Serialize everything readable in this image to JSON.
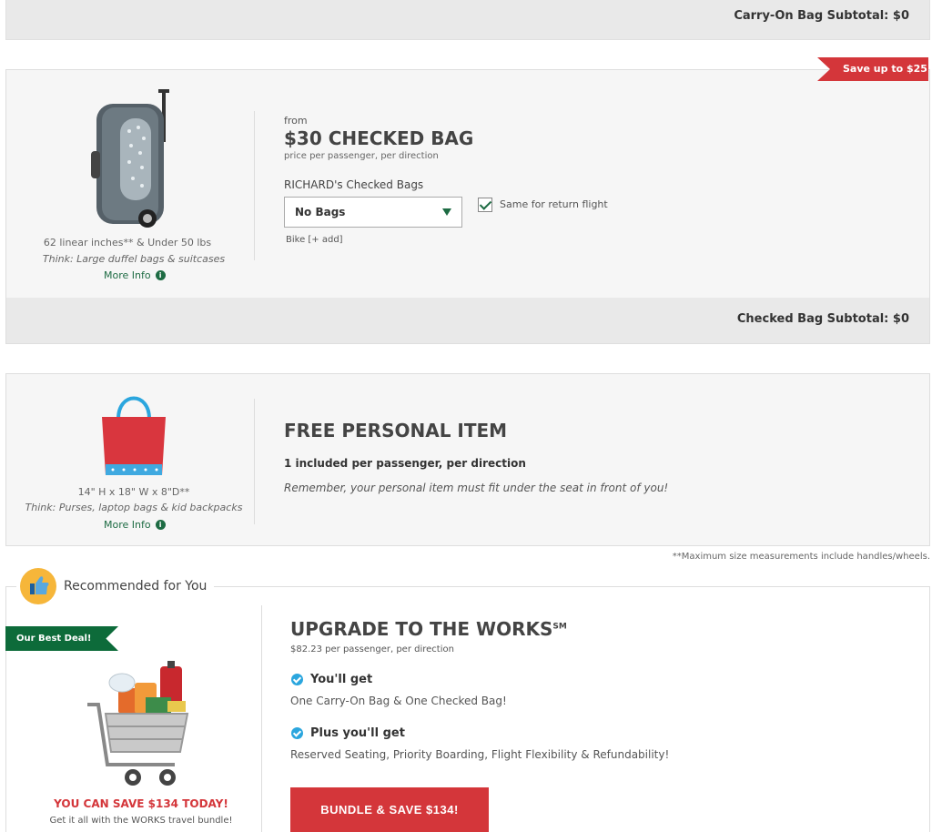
{
  "carryon": {
    "subtotal_label": "Carry-On Bag Subtotal: $0"
  },
  "checked": {
    "ribbon": "Save up to $25",
    "size": "62 linear inches** & Under 50 lbs",
    "think": "Think: Large duffel bags & suitcases",
    "more_info": "More Info",
    "from": "from",
    "title": "$30 CHECKED BAG",
    "subtitle": "price per passenger, per direction",
    "passenger_label": "RICHARD's Checked Bags",
    "select_value": "No Bags",
    "return_label": "Same for return flight",
    "return_checked": true,
    "bike_link": "Bike [+ add]",
    "subtotal_label": "Checked Bag Subtotal: $0"
  },
  "personal": {
    "size": "14\" H x 18\" W x 8\"D**",
    "think": "Think: Purses, laptop bags & kid backpacks",
    "more_info": "More Info",
    "title": "FREE PERSONAL ITEM",
    "subtitle": "1 included per passenger, per direction",
    "note": "Remember, your personal item must fit under the seat in front of you!"
  },
  "footnote": "**Maximum size measurements include handles/wheels.",
  "recommended": {
    "legend": "Recommended for You",
    "best_deal": "Our Best Deal!",
    "title": "UPGRADE TO THE WORKS",
    "title_mark": "SM",
    "price": "$82.23 per passenger, per direction",
    "you_get_head": "You'll get",
    "you_get_text": "One Carry-On Bag & One Checked Bag!",
    "plus_head": "Plus you'll get",
    "plus_text": "Reserved Seating, Priority Boarding, Flight Flexibility & Refundability!",
    "bundle_button": "BUNDLE & SAVE $134!",
    "save_today": "YOU CAN SAVE $134 TODAY!",
    "tagline": "Get it all with the WORKS travel bundle!"
  },
  "colors": {
    "accent_red": "#d4363a",
    "brand_green": "#0d6b3a",
    "check_blue": "#2ba6de"
  }
}
